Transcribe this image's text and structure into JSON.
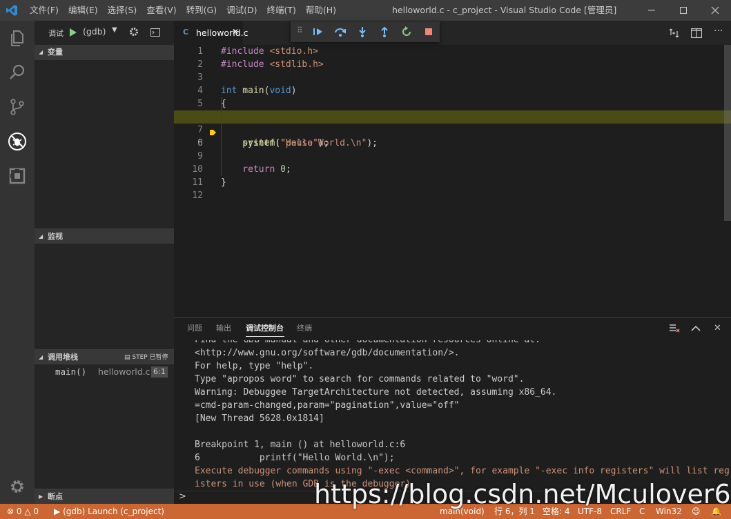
{
  "titlebar": {
    "menu": [
      "文件(F)",
      "编辑(E)",
      "选择(S)",
      "查看(V)",
      "转到(G)",
      "调试(D)",
      "终端(T)",
      "帮助(H)"
    ],
    "title": "helloworld.c - c_project - Visual Studio Code [管理员]"
  },
  "activitybar": {
    "icons": [
      "files-icon",
      "search-icon",
      "source-control-icon",
      "debug-icon",
      "extensions-icon",
      "settings-gear-icon"
    ]
  },
  "sidebar": {
    "debug_label": "调试",
    "config_select": "(gdb)",
    "variables_title": "变量",
    "watch_title": "监视",
    "callstack_title": "调用堆栈",
    "callstack_state": "STEP 已暂停",
    "frame": {
      "function": "main()",
      "file": "helloworld.c",
      "position": "6:1"
    },
    "breakpoints_title": "断点"
  },
  "editor": {
    "tab_lang_icon": "C",
    "tab_label": "helloworld.c",
    "lines": [
      {
        "n": "1"
      },
      {
        "n": "2"
      },
      {
        "n": "3"
      },
      {
        "n": "4"
      },
      {
        "n": "5"
      },
      {
        "n": "6"
      },
      {
        "n": "7"
      },
      {
        "n": "8"
      },
      {
        "n": "9"
      },
      {
        "n": "10"
      },
      {
        "n": "11"
      },
      {
        "n": "12"
      }
    ],
    "code": {
      "l1a": "#include",
      "l1b": " <stdio.h>",
      "l2a": "#include",
      "l2b": " <stdlib.h>",
      "l4a": "int",
      "l4b": " main(",
      "l4c": "void",
      "l4d": ")",
      "l5": "{",
      "l6a": "    printf(",
      "l6b": "\"Hello World.\\n\"",
      "l6c": ");",
      "l8a": "    system(",
      "l8b": "\"pause\"",
      "l8c": ");",
      "l10a": "    return ",
      "l10b": "0",
      "l10c": ";",
      "l11": "}"
    },
    "current_line": "6"
  },
  "panel": {
    "tabs": [
      "问题",
      "输出",
      "调试控制台",
      "终端"
    ],
    "active_tab": "调试控制台",
    "output": [
      "Find the GDB manual and other documentation resources online at:",
      "<http://www.gnu.org/software/gdb/documentation/>.",
      "For help, type \"help\".",
      "Type \"apropos word\" to search for commands related to \"word\".",
      "Warning: Debuggee TargetArchitecture not detected, assuming x86_64.",
      "=cmd-param-changed,param=\"pagination\",value=\"off\"",
      "[New Thread 5628.0x1814]",
      "",
      "Breakpoint 1, main () at helloworld.c:6",
      "6           printf(\"Hello World.\\n\");",
      "Execute debugger commands using \"-exec <command>\", for example \"-exec info registers\" will list reg",
      "isters in use (when GDB is the debugger)"
    ],
    "prompt": ">"
  },
  "statusbar": {
    "errors": "0",
    "warnings": "0",
    "launch": "(gdb) Launch (c_project)",
    "function": "main(void)",
    "position": "行 6，列 1",
    "spaces": "空格: 4",
    "encoding": "UTF-8",
    "eol": "CRLF",
    "language": "C",
    "platform": "Win32"
  },
  "watermark": "https://blog.csdn.net/Mculover666",
  "colors": {
    "statusbar": "#cc6633",
    "breakpoint_line": "#4b4b18",
    "accent": "#007acc"
  }
}
